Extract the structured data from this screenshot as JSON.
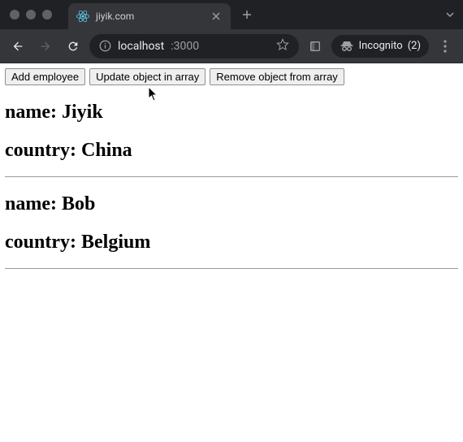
{
  "browser": {
    "tab_title": "jiyik.com",
    "url_host": "localhost",
    "url_port": ":3000",
    "incognito_label": "Incognito",
    "incognito_count": "(2)"
  },
  "buttons": {
    "add": "Add employee",
    "update": "Update object in array",
    "remove": "Remove object from array"
  },
  "labels": {
    "name_prefix": "name: ",
    "country_prefix": "country: "
  },
  "employees": [
    {
      "name": "Jiyik",
      "country": "China"
    },
    {
      "name": "Bob",
      "country": "Belgium"
    }
  ]
}
